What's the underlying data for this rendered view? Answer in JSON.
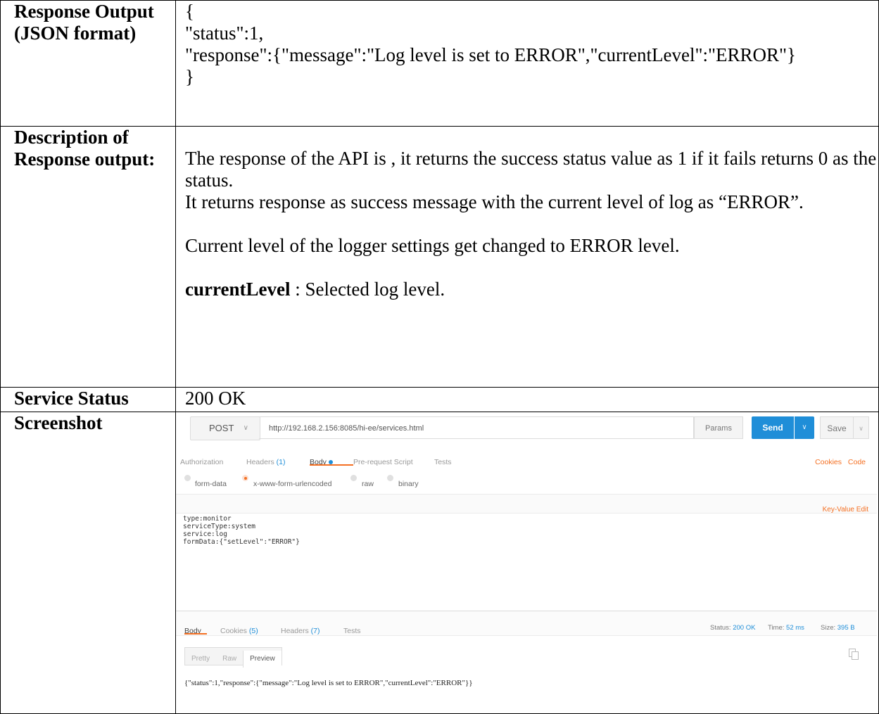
{
  "rows": {
    "response_output": {
      "label": "Response Output (JSON format)",
      "json_lines": [
        "{",
        "\"status\":1,",
        "\"response\":{\"message\":\"Log level is set to ERROR\",\"currentLevel\":\"ERROR\"}",
        "}"
      ]
    },
    "description": {
      "label": "Description of Response output:",
      "para1": "The response of the API is , it returns the success status value as 1 if it fails returns 0 as the status.",
      "para2": "It returns response as success message with the current level of log as “ERROR”.",
      "para3": "Current level of the logger settings get changed to ERROR level.",
      "field_name": "currentLevel",
      "field_desc": " : Selected log level."
    },
    "service_status": {
      "label": "Service Status",
      "value": "200 OK"
    },
    "screenshot": {
      "label": "Screenshot"
    }
  },
  "postman": {
    "method": "POST",
    "url": "http://192.168.2.156:8085/hi-ee/services.html",
    "params_label": "Params",
    "send_label": "Send",
    "save_label": "Save",
    "request_tabs": {
      "authorization": "Authorization",
      "headers": "Headers",
      "headers_count": "(1)",
      "body": "Body",
      "prerequest": "Pre-request Script",
      "tests": "Tests"
    },
    "cookies_link": "Cookies",
    "code_link": "Code",
    "body_types": [
      "form-data",
      "x-www-form-urlencoded",
      "raw",
      "binary"
    ],
    "selected_body_type": "x-www-form-urlencoded",
    "key_value_edit": "Key-Value Edit",
    "request_body": "type:monitor\nserviceType:system\nservice:log\nformData:{\"setLevel\":\"ERROR\"}",
    "response_tabs": {
      "body": "Body",
      "cookies": "Cookies",
      "cookies_count": "(5)",
      "headers": "Headers",
      "headers_count": "(7)",
      "tests": "Tests"
    },
    "status_label": "Status:",
    "status_value": "200 OK",
    "time_label": "Time:",
    "time_value": "52 ms",
    "size_label": "Size:",
    "size_value": "395 B",
    "view_modes": [
      "Pretty",
      "Raw",
      "Preview"
    ],
    "active_view": "Preview",
    "response_body": "{\"status\":1,\"response\":{\"message\":\"Log level is set to ERROR\",\"currentLevel\":\"ERROR\"}}",
    "colors": {
      "accent": "#f47023",
      "send_blue": "#1f8ed8"
    }
  }
}
